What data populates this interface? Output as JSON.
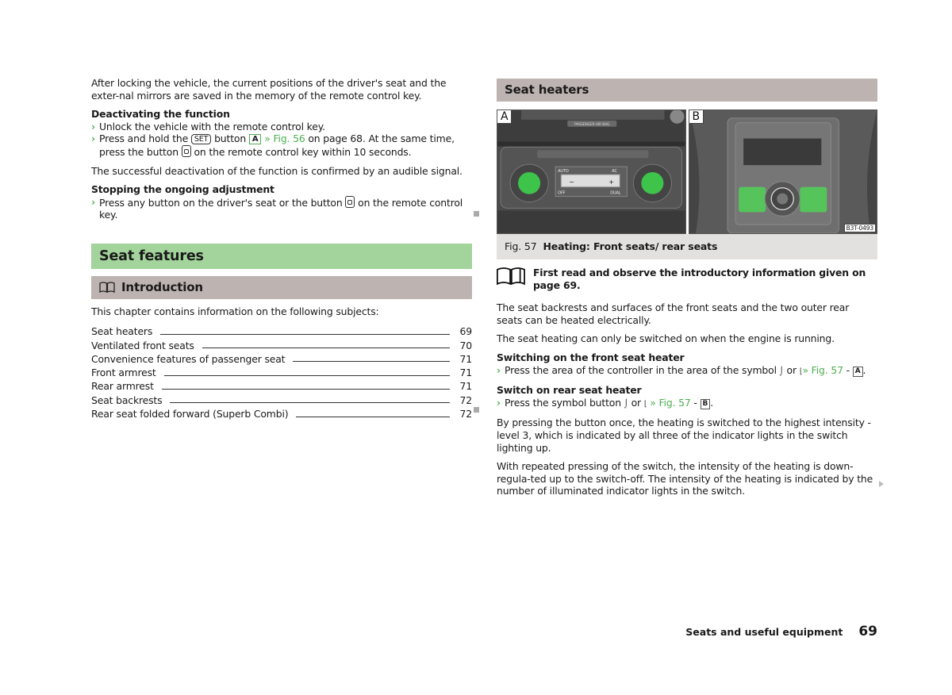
{
  "left": {
    "intro_paragraph": "After locking the vehicle, the current positions of the driver's seat and the exter-nal mirrors are saved in the memory of the remote control key.",
    "deactivating": {
      "heading": "Deactivating the function",
      "step1": "Unlock the vehicle with the remote control key.",
      "step2_a": "Press and hold the ",
      "step2_key": "SET",
      "step2_b": " button ",
      "step2_box": "A",
      "step2_link": " » Fig. 56",
      "step2_c": " on page 68. At the same time, press the button ",
      "step2_d": " on the remote control key within 10 seconds."
    },
    "confirm_paragraph": "The successful deactivation of the function is confirmed by an audible signal.",
    "stopping": {
      "heading": "Stopping the ongoing adjustment",
      "step1_a": "Press any button on the driver's seat or the button ",
      "step1_b": " on the remote control key."
    },
    "section_title": "Seat features",
    "intro_heading": "Introduction",
    "chapter_text": "This chapter contains information on the following subjects:",
    "toc": [
      {
        "label": "Seat heaters",
        "page": "69"
      },
      {
        "label": "Ventilated front seats",
        "page": "70"
      },
      {
        "label": "Convenience features of passenger seat",
        "page": "71"
      },
      {
        "label": "Front armrest",
        "page": "71"
      },
      {
        "label": "Rear armrest",
        "page": "71"
      },
      {
        "label": "Seat backrests",
        "page": "72"
      },
      {
        "label": "Rear seat folded forward (Superb Combi)",
        "page": "72"
      }
    ]
  },
  "right": {
    "heading": "Seat heaters",
    "figure": {
      "panel_a_label": "A",
      "panel_b_label": "B",
      "code": "B3T-0493",
      "panel_a_text": {
        "airbag": "PASSENGER AIR BAG",
        "auto": "AUTO",
        "ac": "AC",
        "off": "OFF",
        "dual": "DUAL",
        "minus": "−",
        "plus": "+"
      },
      "caption_number": "Fig. 57",
      "caption_text": "Heating: Front seats/ rear seats"
    },
    "notice": "First read and observe the introductory information given on page 69.",
    "para1": "The seat backrests and surfaces of the front seats and the two outer rear seats can be heated electrically.",
    "para2": "The seat heating can only be switched on when the engine is running.",
    "front": {
      "heading": "Switching on the front seat heater",
      "step_a": "Press the area of the controller in the area of the symbol ",
      "step_or": " or ",
      "step_link": "» Fig. 57",
      "step_dash": " - ",
      "step_box": "A",
      "step_end": "."
    },
    "rear": {
      "heading": "Switch on rear seat heater",
      "step_a": "Press the symbol button ",
      "step_or": " or ",
      "step_link": " » Fig. 57",
      "step_dash": " - ",
      "step_box": "B",
      "step_end": "."
    },
    "para3": "By pressing the button once, the heating is switched to the highest intensity - level 3, which is indicated by all three of the indicator lights in the switch lighting up.",
    "para4": "With repeated pressing of the switch, the intensity of the heating is down-regula-ted up to the switch-off. The intensity of the heating is indicated by the number of illuminated indicator lights in the switch."
  },
  "footer": {
    "title": "Seats and useful equipment",
    "page": "69"
  },
  "icons": {
    "chevron": "›",
    "seat_back": "⌡",
    "seat_surface": "⌊"
  }
}
